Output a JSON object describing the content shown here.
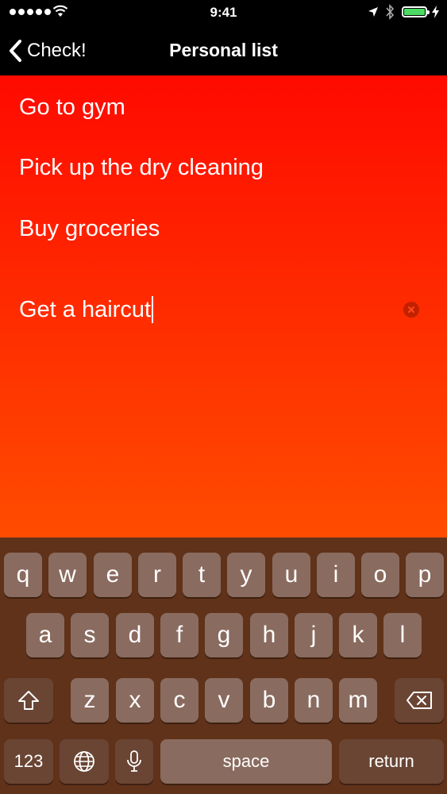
{
  "status_bar": {
    "time": "9:41",
    "signal_dots": 5,
    "battery_level": 1.0,
    "battery_color": "#4cd964"
  },
  "nav": {
    "back_label": "Check!",
    "title": "Personal list"
  },
  "list": {
    "items": [
      "Go to gym",
      "Pick up the dry cleaning",
      "Buy groceries"
    ],
    "editing_value": "Get a haircut",
    "gradient_top": "#ff0a00",
    "gradient_bottom": "#ff4c00"
  },
  "keyboard": {
    "row1": [
      "q",
      "w",
      "e",
      "r",
      "t",
      "y",
      "u",
      "i",
      "o",
      "p"
    ],
    "row2": [
      "a",
      "s",
      "d",
      "f",
      "g",
      "h",
      "j",
      "k",
      "l"
    ],
    "row3": [
      "z",
      "x",
      "c",
      "v",
      "b",
      "n",
      "m"
    ],
    "numbers_label": "123",
    "space_label": "space",
    "return_label": "return"
  }
}
